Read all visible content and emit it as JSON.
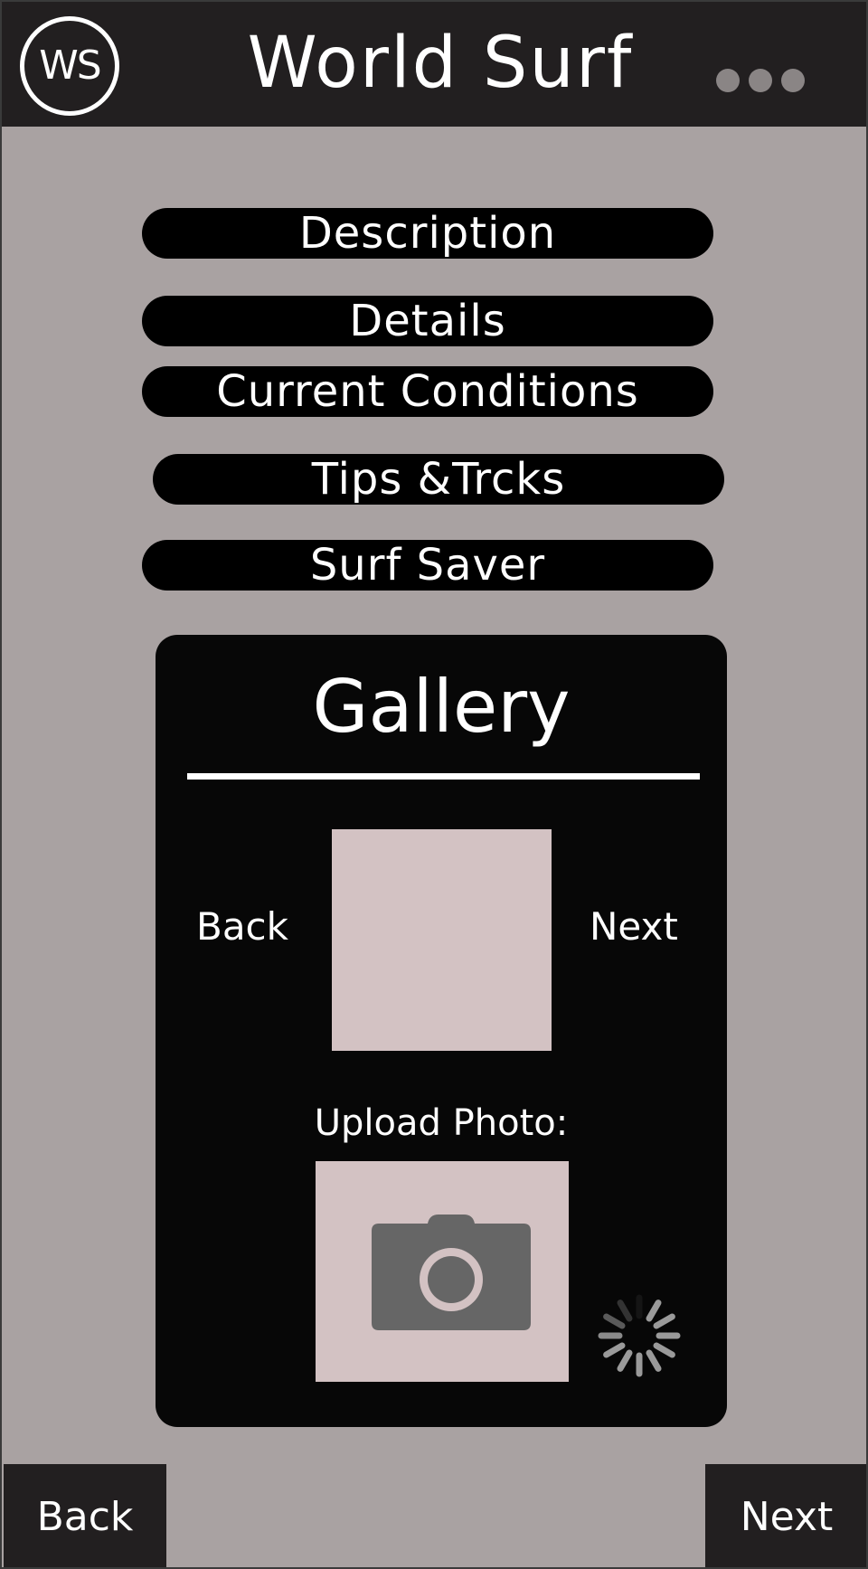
{
  "header": {
    "logo_text": "WS",
    "title": "World Surf"
  },
  "nav": {
    "description": "Description",
    "details": "Details",
    "current_conditions": "Current Conditions",
    "tips": "Tips &Trcks",
    "surf_saver": "Surf Saver"
  },
  "gallery": {
    "title": "Gallery",
    "back": "Back",
    "next": "Next",
    "upload_label": "Upload Photo:"
  },
  "footer": {
    "back": "Back",
    "next": "Next"
  },
  "colors": {
    "background": "#a9a2a2",
    "header": "#221f20",
    "panel": "#070707",
    "placeholder": "#d3c2c3",
    "icon": "#666666"
  },
  "icons": [
    "more-icon",
    "camera-icon",
    "spinner-icon"
  ]
}
